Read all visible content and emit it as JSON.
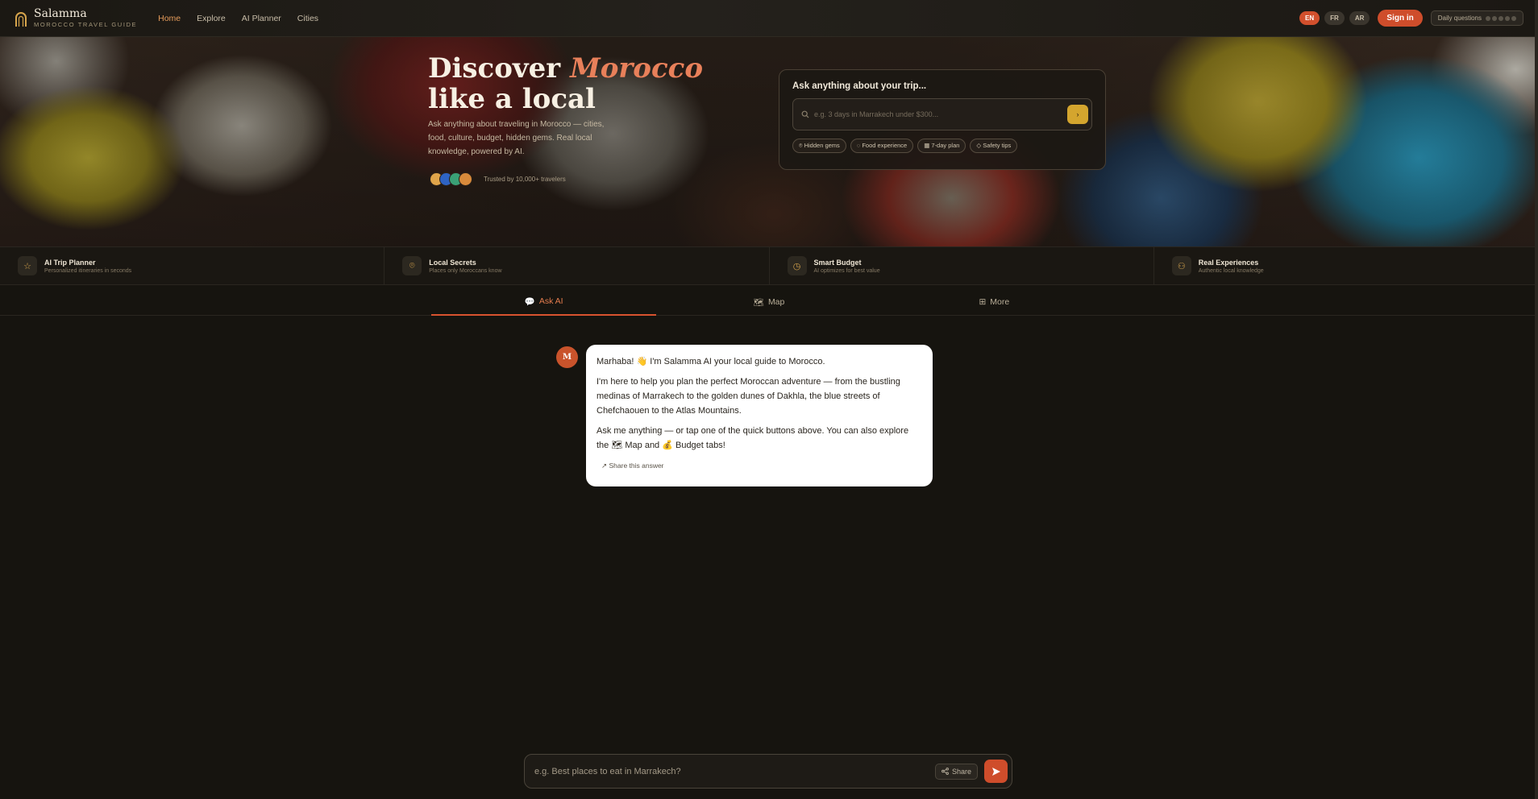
{
  "brand": {
    "name": "Salamma",
    "tagline": "MOROCCO TRAVEL GUIDE"
  },
  "nav": {
    "links": [
      {
        "label": "Home",
        "active": true
      },
      {
        "label": "Explore",
        "active": false
      },
      {
        "label": "AI Planner",
        "active": false
      },
      {
        "label": "Cities",
        "active": false
      }
    ],
    "languages": [
      {
        "label": "EN",
        "active": true
      },
      {
        "label": "FR",
        "active": false
      },
      {
        "label": "AR",
        "active": false
      }
    ],
    "signin_label": "Sign in",
    "daily_label": "Daily questions"
  },
  "hero": {
    "title_line1": "Discover ",
    "title_accent": "Morocco",
    "title_line2": "like a local",
    "subtitle": "Ask anything about traveling in Morocco — cities, food, culture, budget, hidden gems. Real local knowledge, powered by AI.",
    "trust_text": "Trusted by 10,000+ travelers",
    "avatar_colors": [
      "#e0a44a",
      "#2e63c4",
      "#3aa176",
      "#d98a3b"
    ]
  },
  "ask_card": {
    "title": "Ask anything about your trip...",
    "placeholder": "e.g. 3 days in Marrakech under $300...",
    "chips": [
      "Hidden gems",
      "Food experience",
      "7-day plan",
      "Safety tips"
    ]
  },
  "features": [
    {
      "icon": "star-icon",
      "title": "AI Trip Planner",
      "subtitle": "Personalized itineraries in seconds"
    },
    {
      "icon": "location-pin-icon",
      "title": "Local Secrets",
      "subtitle": "Places only Moroccans know"
    },
    {
      "icon": "clock-icon",
      "title": "Smart Budget",
      "subtitle": "AI optimizes for best value"
    },
    {
      "icon": "users-icon",
      "title": "Real Experiences",
      "subtitle": "Authentic local knowledge"
    }
  ],
  "tabs": [
    {
      "label": "Ask AI",
      "icon": "💬",
      "active": true
    },
    {
      "label": "Map",
      "icon": "🗺",
      "active": false
    },
    {
      "label": "More",
      "icon": "⊞",
      "active": false
    }
  ],
  "chat": {
    "avatar_letter": "M",
    "messages": [
      "Marhaba! 👋 I'm Salamma AI your local guide to Morocco.",
      "I'm here to help you plan the perfect Moroccan adventure — from the bustling medinas of Marrakech to the golden dunes of Dakhla, the blue streets of Chefchaouen to the Atlas Mountains.",
      "Ask me anything — or tap one of the quick buttons above. You can also explore the 🗺 Map and 💰 Budget tabs!"
    ],
    "share_label": "↗ Share this answer"
  },
  "composer": {
    "placeholder": "e.g. Best places to eat in Marrakech?",
    "share_label": "Share"
  },
  "colors": {
    "accent": "#cf4d2b",
    "gold": "#d4a52e",
    "background": "#16140f"
  }
}
